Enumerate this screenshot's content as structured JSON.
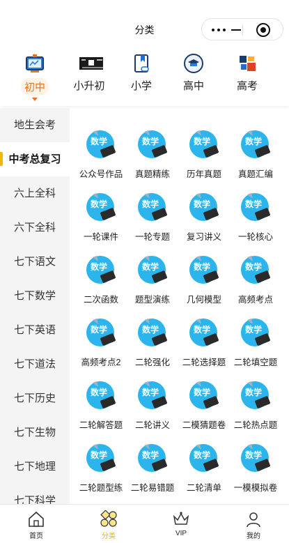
{
  "nav": {
    "title": "分类"
  },
  "level_tabs": [
    {
      "label": "初中",
      "icon": "blackboard-icon",
      "active": true
    },
    {
      "label": "小升初",
      "icon": "classroom-icon",
      "active": false
    },
    {
      "label": "小学",
      "icon": "book-icon",
      "active": false
    },
    {
      "label": "高中",
      "icon": "graduation-cap-icon",
      "active": false
    },
    {
      "label": "高考",
      "icon": "gaokao-icon",
      "active": false
    }
  ],
  "sidebar": {
    "items": [
      "地生会考",
      "中考总复习",
      "六上全科",
      "六下全科",
      "七下语文",
      "七下数学",
      "七下英语",
      "七下道法",
      "七下历史",
      "七下生物",
      "七下地理",
      "七下科学"
    ],
    "active_index": 1
  },
  "grid": {
    "badge_text": "数学",
    "items": [
      "公众号作品",
      "真题精练",
      "历年真题",
      "真题汇编",
      "一轮课件",
      "一轮专题",
      "复习讲义",
      "一轮核心",
      "二次函数",
      "题型演练",
      "几何模型",
      "高频考点",
      "高频考点2",
      "二轮强化",
      "二轮选择题",
      "二轮填空题",
      "二轮解答题",
      "二轮讲义",
      "二模猜题卷",
      "二轮热点题",
      "二轮题型练",
      "二轮易错题",
      "二轮清单",
      "一模模拟卷"
    ]
  },
  "tabbar": [
    {
      "label": "首页",
      "icon": "home-icon",
      "active": false
    },
    {
      "label": "分类",
      "icon": "category-icon",
      "active": true
    },
    {
      "label": "VIP",
      "icon": "crown-icon",
      "active": false
    },
    {
      "label": "我的",
      "icon": "user-icon",
      "active": false
    }
  ],
  "colors": {
    "accent": "#e8731c",
    "active_tab": "#e6b800",
    "icon_blue": "#2bb5ec",
    "sidebar_bg": "#f4f4f4"
  }
}
